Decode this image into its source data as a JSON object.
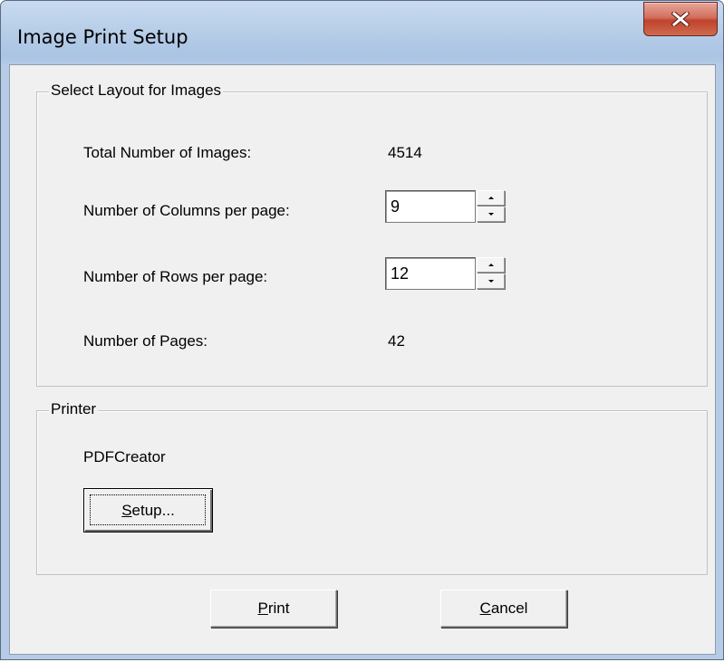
{
  "window": {
    "title": "Image Print Setup"
  },
  "layout_group": {
    "label": "Select Layout for Images",
    "total_images_label": "Total Number of Images:",
    "total_images_value": "4514",
    "columns_label": "Number of Columns per page:",
    "columns_value": "9",
    "rows_label": "Number of Rows per page:",
    "rows_value": "12",
    "pages_label": "Number of Pages:",
    "pages_value": "42"
  },
  "printer_group": {
    "label": "Printer",
    "printer_name": "PDFCreator",
    "setup_button": {
      "mnemonic": "S",
      "rest": "etup..."
    }
  },
  "buttons": {
    "print": {
      "mnemonic": "P",
      "rest": "rint"
    },
    "cancel": {
      "mnemonic": "C",
      "rest": "ancel"
    }
  },
  "icons": {
    "close": "close-icon",
    "spin_up": "chevron-up-icon",
    "spin_down": "chevron-down-icon"
  },
  "colors": {
    "close_button": "#c7452f",
    "dialog_background": "#f0f0f0",
    "title_bar": "#b9cfe9"
  }
}
